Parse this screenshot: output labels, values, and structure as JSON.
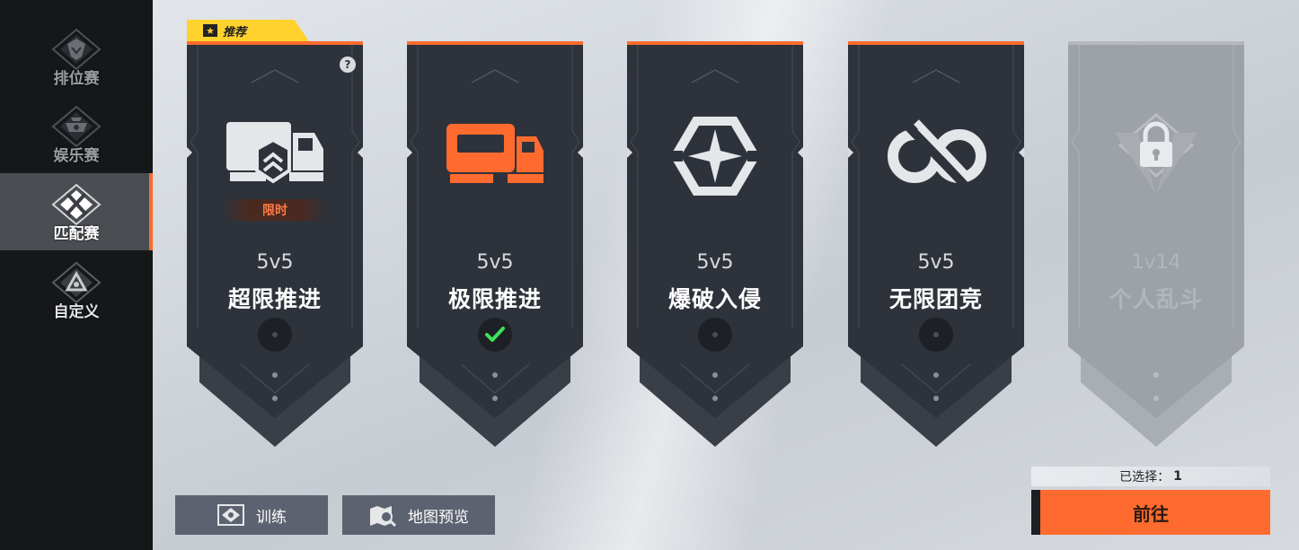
{
  "sidebar": {
    "items": [
      {
        "label": "排位赛",
        "icon": "rank-icon",
        "active": false
      },
      {
        "label": "娱乐赛",
        "icon": "fun-icon",
        "active": false
      },
      {
        "label": "匹配赛",
        "icon": "crossed-swords-icon",
        "active": true
      },
      {
        "label": "自定义",
        "icon": "custom-icon",
        "active": false
      }
    ]
  },
  "recommend": {
    "label": "推荐",
    "icon": "star-icon"
  },
  "cards": [
    {
      "count": "5v5",
      "name": "超限推进",
      "badge": "限时",
      "icon": "truck-shield-icon",
      "selected": false,
      "locked": false,
      "help": "?"
    },
    {
      "count": "5v5",
      "name": "极限推进",
      "icon": "cargo-truck-icon",
      "selected": true,
      "locked": false
    },
    {
      "count": "5v5",
      "name": "爆破入侵",
      "icon": "compass-star-icon",
      "selected": false,
      "locked": false
    },
    {
      "count": "5v5",
      "name": "无限团竞",
      "icon": "infinity-icon",
      "selected": false,
      "locked": false
    },
    {
      "count": "1v14",
      "name": "个人乱斗",
      "icon": "lock-icon",
      "selected": false,
      "locked": true
    }
  ],
  "bottom": {
    "training_label": "训练",
    "map_preview_label": "地图预览",
    "selected_label": "已选择：",
    "selected_count": "1",
    "go_label": "前往"
  },
  "colors": {
    "accent": "#ff6b2e",
    "card_dark": "#2e333b",
    "sidebar": "#151719",
    "recommend": "#ffd22e",
    "check": "#3ee05a"
  }
}
